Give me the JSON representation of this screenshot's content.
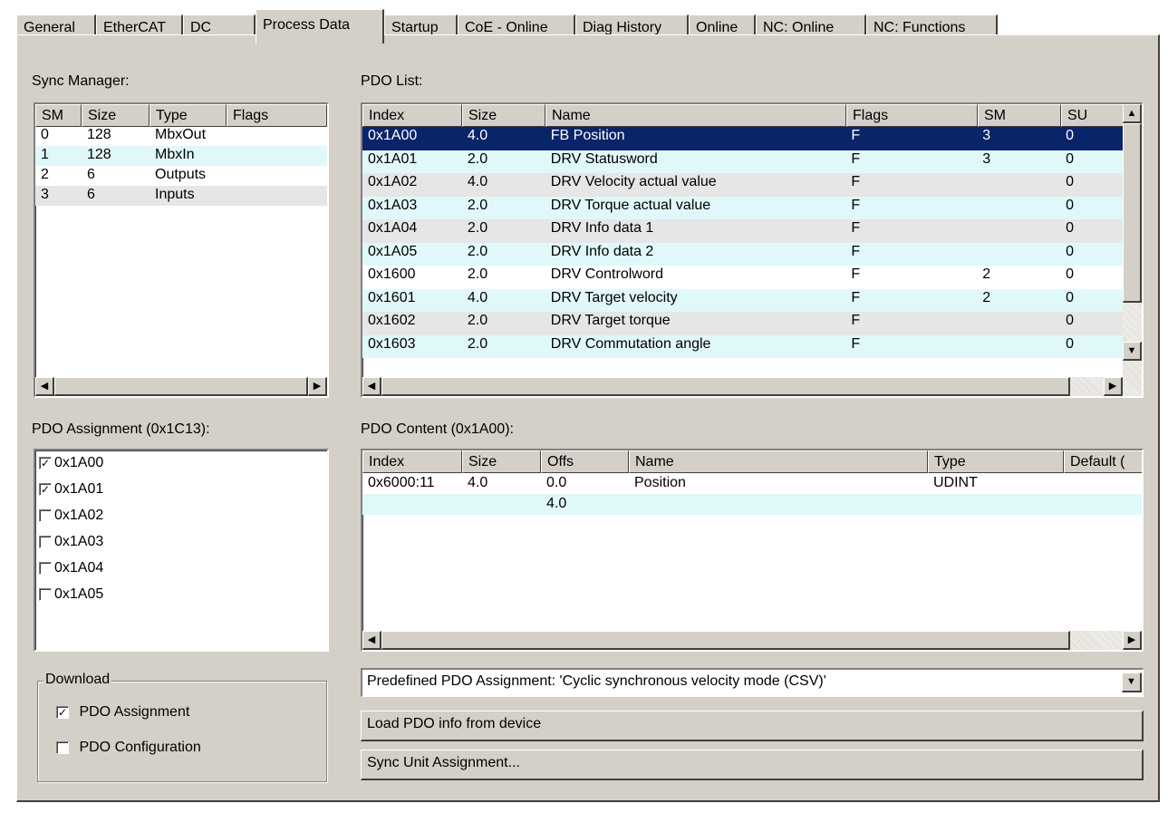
{
  "tabs": [
    {
      "label": "General",
      "active": false
    },
    {
      "label": "EtherCAT",
      "active": false
    },
    {
      "label": "DC",
      "active": false
    },
    {
      "label": "Process Data",
      "active": true
    },
    {
      "label": "Startup",
      "active": false
    },
    {
      "label": "CoE - Online",
      "active": false
    },
    {
      "label": "Diag History",
      "active": false
    },
    {
      "label": "Online",
      "active": false
    },
    {
      "label": "NC: Online",
      "active": false
    },
    {
      "label": "NC: Functions",
      "active": false
    }
  ],
  "sync_manager": {
    "label": "Sync Manager:",
    "columns": [
      "SM",
      "Size",
      "Type",
      "Flags"
    ],
    "rows": [
      [
        "0",
        "128",
        "MbxOut",
        ""
      ],
      [
        "1",
        "128",
        "MbxIn",
        ""
      ],
      [
        "2",
        "6",
        "Outputs",
        ""
      ],
      [
        "3",
        "6",
        "Inputs",
        ""
      ]
    ]
  },
  "pdo_list": {
    "label": "PDO List:",
    "columns": [
      "Index",
      "Size",
      "Name",
      "Flags",
      "SM",
      "SU"
    ],
    "rows": [
      [
        "0x1A00",
        "4.0",
        "FB Position",
        "F",
        "3",
        "0"
      ],
      [
        "0x1A01",
        "2.0",
        "DRV Statusword",
        "F",
        "3",
        "0"
      ],
      [
        "0x1A02",
        "4.0",
        "DRV Velocity actual value",
        "F",
        "",
        "0"
      ],
      [
        "0x1A03",
        "2.0",
        "DRV Torque actual value",
        "F",
        "",
        "0"
      ],
      [
        "0x1A04",
        "2.0",
        "DRV Info data 1",
        "F",
        "",
        "0"
      ],
      [
        "0x1A05",
        "2.0",
        "DRV Info data 2",
        "F",
        "",
        "0"
      ],
      [
        "0x1600",
        "2.0",
        "DRV Controlword",
        "F",
        "2",
        "0"
      ],
      [
        "0x1601",
        "4.0",
        "DRV Target velocity",
        "F",
        "2",
        "0"
      ],
      [
        "0x1602",
        "2.0",
        "DRV Target torque",
        "F",
        "",
        "0"
      ],
      [
        "0x1603",
        "2.0",
        "DRV Commutation angle",
        "F",
        "",
        "0"
      ]
    ]
  },
  "pdo_assignment": {
    "label": "PDO Assignment (0x1C13):",
    "items": [
      {
        "label": "0x1A00",
        "checked": true
      },
      {
        "label": "0x1A01",
        "checked": true
      },
      {
        "label": "0x1A02",
        "checked": false
      },
      {
        "label": "0x1A03",
        "checked": false
      },
      {
        "label": "0x1A04",
        "checked": false
      },
      {
        "label": "0x1A05",
        "checked": false
      }
    ]
  },
  "pdo_content": {
    "label": "PDO Content (0x1A00):",
    "columns": [
      "Index",
      "Size",
      "Offs",
      "Name",
      "Type",
      "Default ("
    ],
    "rows": [
      [
        "0x6000:11",
        "4.0",
        "0.0",
        "Position",
        "UDINT",
        ""
      ],
      [
        "",
        "",
        "4.0",
        "",
        "",
        ""
      ]
    ]
  },
  "download": {
    "title": "Download",
    "pdo_assignment_label": "PDO Assignment",
    "pdo_assignment_checked": true,
    "pdo_configuration_label": "PDO Configuration",
    "pdo_configuration_checked": false
  },
  "predefined_combo": "Predefined PDO Assignment: 'Cyclic synchronous velocity mode (CSV)'",
  "buttons": {
    "load_pdo": "Load PDO info from device",
    "sync_unit": "Sync Unit Assignment..."
  },
  "colors": {
    "face": "#d4d0c8",
    "selection": "#0a246a",
    "row_cyan": "#e0f8fa",
    "row_gray": "#e6e6e6"
  }
}
